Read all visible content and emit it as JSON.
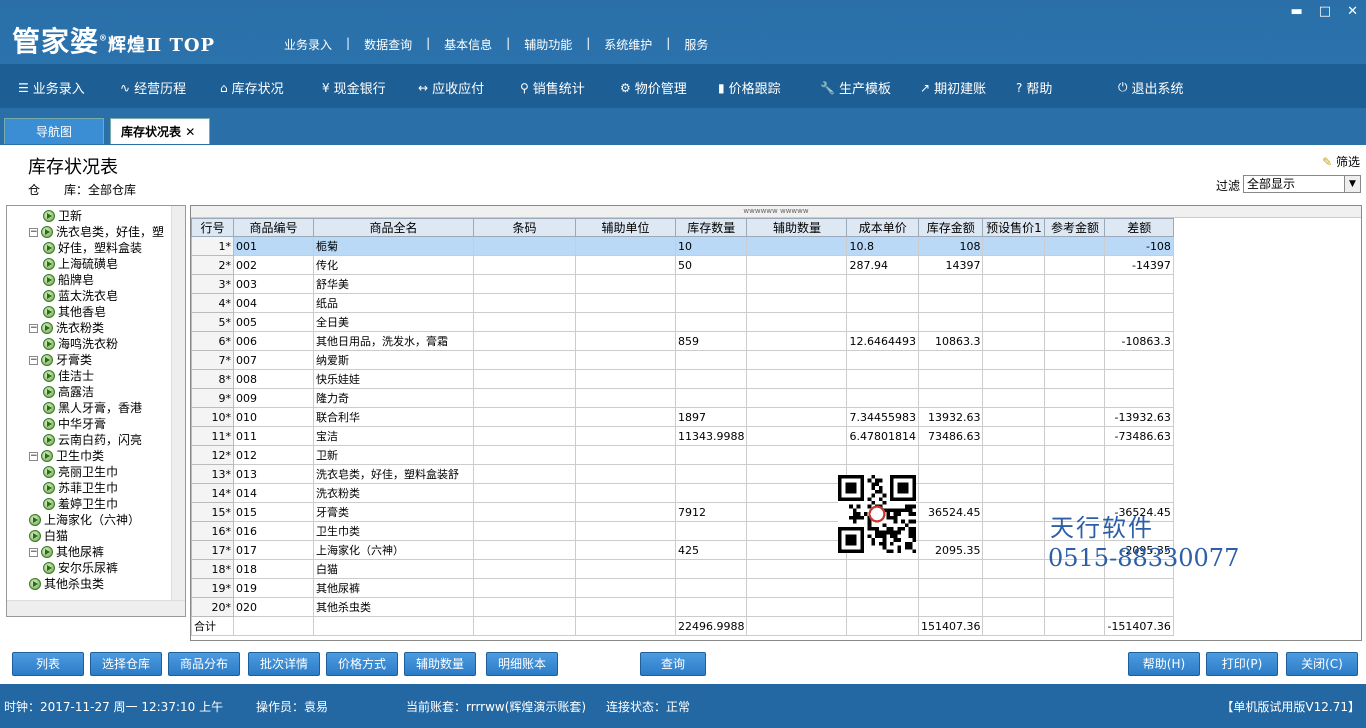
{
  "app": {
    "logo": "管家婆",
    "logo_sub": "辉煌Ⅱ TOP",
    "reg": "®"
  },
  "topmenu": [
    "业务录入",
    "数据查询",
    "基本信息",
    "辅助功能",
    "系统维护",
    "服务"
  ],
  "winctl": {
    "min": "▬",
    "max": "□",
    "close": "✕"
  },
  "navbar": [
    {
      "icon": "☰",
      "label": "业务录入"
    },
    {
      "icon": "∿",
      "label": "经营历程"
    },
    {
      "icon": "⌂",
      "label": "库存状况"
    },
    {
      "icon": "¥",
      "label": "现金银行"
    },
    {
      "icon": "↔",
      "label": "应收应付"
    },
    {
      "icon": "⚲",
      "label": "销售统计"
    },
    {
      "icon": "⚙",
      "label": "物价管理"
    },
    {
      "icon": "▮",
      "label": "价格跟踪"
    },
    {
      "icon": "🔧",
      "label": "生产模板"
    },
    {
      "icon": "↗",
      "label": "期初建账"
    },
    {
      "icon": "?",
      "label": "帮助"
    },
    {
      "icon": "⏻",
      "label": "退出系统"
    }
  ],
  "tabs": [
    {
      "label": "导航图"
    },
    {
      "label": "库存状况表",
      "close": "✕"
    }
  ],
  "page": {
    "title": "库存状况表",
    "warehouse_label": "仓　　库：",
    "warehouse": "全部仓库",
    "filter_btn": "筛选",
    "filter_label": "过滤",
    "filter_value": "全部显示"
  },
  "tree": [
    {
      "label": "卫新",
      "lvl": 2
    },
    {
      "label": "洗衣皂类，好佳，塑",
      "lvl": 1,
      "exp": "−"
    },
    {
      "label": "好佳，塑料盒装",
      "lvl": 2
    },
    {
      "label": "上海硫磺皂",
      "lvl": 2
    },
    {
      "label": "船牌皂",
      "lvl": 2
    },
    {
      "label": "蓝太洗衣皂",
      "lvl": 2
    },
    {
      "label": "其他香皂",
      "lvl": 2
    },
    {
      "label": "洗衣粉类",
      "lvl": 1,
      "exp": "−"
    },
    {
      "label": "海鸣洗衣粉",
      "lvl": 2
    },
    {
      "label": "牙膏类",
      "lvl": 1,
      "exp": "−"
    },
    {
      "label": "佳洁士",
      "lvl": 2
    },
    {
      "label": "高露洁",
      "lvl": 2
    },
    {
      "label": "黑人牙膏，香港",
      "lvl": 2
    },
    {
      "label": "中华牙膏",
      "lvl": 2
    },
    {
      "label": "云南白药，闪亮",
      "lvl": 2
    },
    {
      "label": "卫生巾类",
      "lvl": 1,
      "exp": "−"
    },
    {
      "label": "亮丽卫生巾",
      "lvl": 2
    },
    {
      "label": "苏菲卫生巾",
      "lvl": 2
    },
    {
      "label": "羞婷卫生巾",
      "lvl": 2
    },
    {
      "label": "上海家化（六神）",
      "lvl": 1
    },
    {
      "label": "白猫",
      "lvl": 1
    },
    {
      "label": "其他尿裤",
      "lvl": 1,
      "exp": "−"
    },
    {
      "label": "安尔乐尿裤",
      "lvl": 2
    },
    {
      "label": "其他杀虫类",
      "lvl": 1
    }
  ],
  "grid": {
    "top_marker": "wwwwww  wwwww",
    "headers": [
      "行号",
      "商品编号",
      "商品全名",
      "条码",
      "辅助单位",
      "库存数量",
      "辅助数量",
      "成本单价",
      "库存金额",
      "预设售价1",
      "参考金额",
      "差额"
    ],
    "rows": [
      [
        "1*",
        "001",
        "栀菊",
        "",
        "",
        "10",
        "",
        "10.8",
        "108",
        "",
        "",
        "-108"
      ],
      [
        "2*",
        "002",
        "传化",
        "",
        "",
        "50",
        "",
        "287.94",
        "14397",
        "",
        "",
        "-14397"
      ],
      [
        "3*",
        "003",
        "舒华美",
        "",
        "",
        "",
        "",
        "",
        "",
        "",
        "",
        ""
      ],
      [
        "4*",
        "004",
        "纸品",
        "",
        "",
        "",
        "",
        "",
        "",
        "",
        "",
        ""
      ],
      [
        "5*",
        "005",
        "全日美",
        "",
        "",
        "",
        "",
        "",
        "",
        "",
        "",
        ""
      ],
      [
        "6*",
        "006",
        "其他日用品，洗发水，膏霜",
        "",
        "",
        "859",
        "",
        "12.6464493",
        "10863.3",
        "",
        "",
        "-10863.3"
      ],
      [
        "7*",
        "007",
        "纳爱斯",
        "",
        "",
        "",
        "",
        "",
        "",
        "",
        "",
        ""
      ],
      [
        "8*",
        "008",
        "快乐娃娃",
        "",
        "",
        "",
        "",
        "",
        "",
        "",
        "",
        ""
      ],
      [
        "9*",
        "009",
        "隆力奇",
        "",
        "",
        "",
        "",
        "",
        "",
        "",
        "",
        ""
      ],
      [
        "10*",
        "010",
        "联合利华",
        "",
        "",
        "1897",
        "",
        "7.34455983",
        "13932.63",
        "",
        "",
        "-13932.63"
      ],
      [
        "11*",
        "011",
        "宝洁",
        "",
        "",
        "11343.9988",
        "",
        "6.47801814",
        "73486.63",
        "",
        "",
        "-73486.63"
      ],
      [
        "12*",
        "012",
        "卫新",
        "",
        "",
        "",
        "",
        "",
        "",
        "",
        "",
        ""
      ],
      [
        "13*",
        "013",
        "洗衣皂类，好佳，塑料盒装舒",
        "",
        "",
        "",
        "",
        "",
        "",
        "",
        "",
        ""
      ],
      [
        "14*",
        "014",
        "洗衣粉类",
        "",
        "",
        "",
        "",
        "",
        "",
        "",
        "",
        ""
      ],
      [
        "15*",
        "015",
        "牙膏类",
        "",
        "",
        "7912",
        "",
        "",
        "36524.45",
        "",
        "",
        "-36524.45"
      ],
      [
        "16*",
        "016",
        "卫生巾类",
        "",
        "",
        "",
        "",
        "",
        "",
        "",
        "",
        ""
      ],
      [
        "17*",
        "017",
        "上海家化（六神）",
        "",
        "",
        "425",
        "",
        "",
        "2095.35",
        "",
        "",
        "-2095.35"
      ],
      [
        "18*",
        "018",
        "白猫",
        "",
        "",
        "",
        "",
        "",
        "",
        "",
        "",
        ""
      ],
      [
        "19*",
        "019",
        "其他尿裤",
        "",
        "",
        "",
        "",
        "",
        "",
        "",
        "",
        ""
      ],
      [
        "20*",
        "020",
        "其他杀虫类",
        "",
        "",
        "",
        "",
        "",
        "",
        "",
        "",
        ""
      ]
    ],
    "total": [
      "合计",
      "",
      "",
      "",
      "",
      "22496.9988",
      "",
      "",
      "151407.36",
      "",
      "",
      "-151407.36"
    ]
  },
  "watermark": {
    "line1": "天行软件",
    "line2": "0515-88330077"
  },
  "buttons_left": [
    "列表",
    "选择仓库",
    "商品分布",
    "批次详情",
    "价格方式",
    "辅助数量",
    "明细账本"
  ],
  "button_query": "查询",
  "buttons_right": [
    "帮助(H)",
    "打印(P)",
    "关闭(C)"
  ],
  "status": {
    "clock": "时钟：2017-11-27 周一 12:37:10 上午",
    "operator": "操作员：袁易",
    "account": "当前账套：rrrrww(辉煌演示账套)",
    "conn": "连接状态：正常",
    "version": "【单机版试用版V12.71】"
  }
}
